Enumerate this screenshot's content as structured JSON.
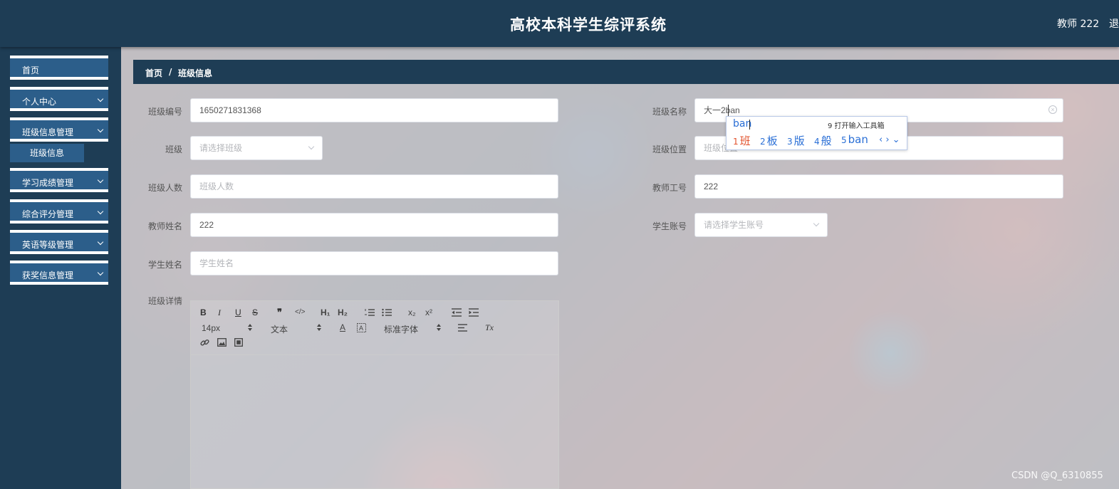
{
  "header": {
    "title": "高校本科学生综评系统",
    "user": "教师 222",
    "logout": "退"
  },
  "sidebar": {
    "items": [
      {
        "label": "首页"
      },
      {
        "label": "个人中心"
      },
      {
        "label": "班级信息管理"
      },
      {
        "label": "学习成绩管理"
      },
      {
        "label": "综合评分管理"
      },
      {
        "label": "英语等级管理"
      },
      {
        "label": "获奖信息管理"
      }
    ],
    "submenu": {
      "label": "班级信息"
    }
  },
  "breadcrumb": {
    "home": "首页",
    "separator": "/",
    "current": "班级信息"
  },
  "form": {
    "class_no": {
      "label": "班级编号",
      "value": "1650271831368"
    },
    "class_name": {
      "label": "班级名称",
      "value": "大一2ban"
    },
    "class": {
      "label": "班级",
      "placeholder": "请选择班级"
    },
    "class_location": {
      "label": "班级位置",
      "placeholder": "班级位置"
    },
    "class_size": {
      "label": "班级人数",
      "placeholder": "班级人数"
    },
    "teacher_id": {
      "label": "教师工号",
      "value": "222"
    },
    "teacher_name": {
      "label": "教师姓名",
      "value": "222"
    },
    "student_account": {
      "label": "学生账号",
      "placeholder": "请选择学生账号"
    },
    "student_name": {
      "label": "学生姓名",
      "placeholder": "学生姓名"
    },
    "details": {
      "label": "班级详情"
    }
  },
  "editor": {
    "font_size": "14px",
    "format": "文本",
    "font": "标准字体",
    "buttons": {
      "bold": "B",
      "italic": "I",
      "underline": "U",
      "strike": "S",
      "quote": "❞",
      "code": "</>",
      "h1": "H₁",
      "h2": "H₂",
      "subscript": "x₂",
      "superscript": "x²",
      "color": "A",
      "clean": "Tx"
    }
  },
  "ime": {
    "input": "ban",
    "toolbox": "9 打开输入工具箱",
    "candidates": [
      {
        "num": "1",
        "text": "班"
      },
      {
        "num": "2",
        "text": "板"
      },
      {
        "num": "3",
        "text": "版"
      },
      {
        "num": "4",
        "text": "般"
      },
      {
        "num": "5",
        "text": "ban"
      }
    ],
    "arrows": "‹ › ⌄"
  },
  "watermark": "CSDN @Q_6310855",
  "colors": {
    "header": "#1e3d55",
    "menu": "#2c5e8a",
    "ime_blue": "#2a6fd6",
    "ime_active": "#e2512b"
  }
}
